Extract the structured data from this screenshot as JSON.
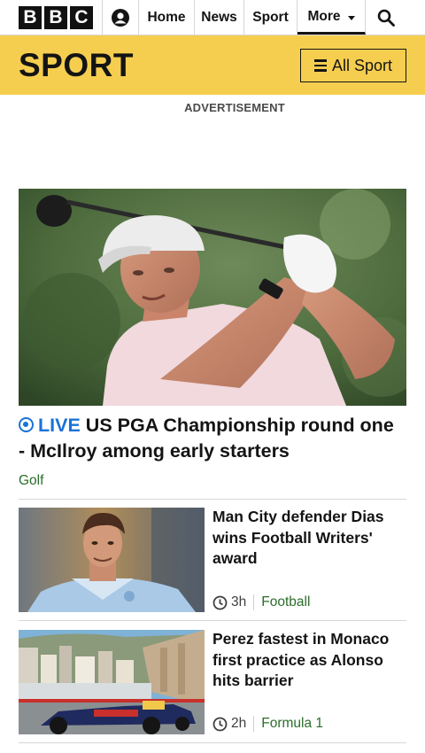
{
  "nav": {
    "logo_letters": [
      "B",
      "B",
      "C"
    ],
    "items": [
      "Home",
      "News",
      "Sport",
      "More"
    ],
    "account_icon": "account-icon",
    "search_icon": "search-icon"
  },
  "section": {
    "title": "SPORT",
    "all_sport_label": "All Sport",
    "brand_color": "#f6ce4f"
  },
  "advert_label": "ADVERTISEMENT",
  "hero": {
    "live_label": "LIVE",
    "headline": "US PGA Championship round one - McIlroy among early starters",
    "tag": "Golf",
    "live_color": "#1a73d6"
  },
  "stories": [
    {
      "headline": "Man City defender Dias wins Football Writers' award",
      "time": "3h",
      "category": "Football"
    },
    {
      "headline": "Perez fastest in Monaco first practice as Alonso hits barrier",
      "time": "2h",
      "category": "Formula 1"
    }
  ]
}
